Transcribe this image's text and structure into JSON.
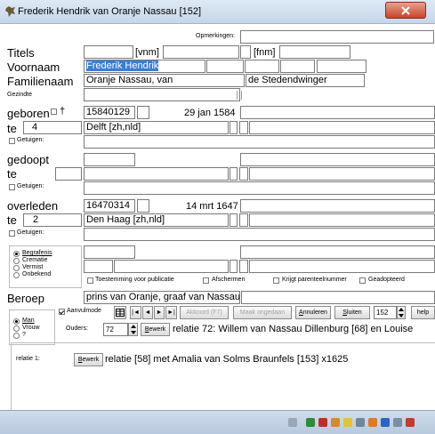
{
  "window": {
    "title": "Frederik Hendrik van Oranje Nassau [152]"
  },
  "labels": {
    "opmerkingen": "Opmerkingen:",
    "titels": "Titels",
    "vnm": "[vnm]",
    "fnm": "[fnm]",
    "voornaam": "Voornaam",
    "familienaam": "Familienaam",
    "gezindte": "Gezindte",
    "geboren": "geboren",
    "dagger": "†",
    "te": "te",
    "getuigen": "Getuigen:",
    "gedoopt": "gedoopt",
    "overleden": "overleden",
    "beroep": "Beroep",
    "toestemming": "Toestemming voor publicatie",
    "afschermen": "Afschermen",
    "krijgt_parenteelnummer": "Krijgt parenteelnummer",
    "geadopteerd": "Geadopteerd",
    "aanvulmode": "Aanvulmode",
    "ouders": "Ouders:",
    "relatie1": "relatie 1:"
  },
  "fields": {
    "voornaam": "Frederik Hendrik",
    "familienaam": "Oranje Nassau, van",
    "familienaam_extra": "de Stedendwinger",
    "geboren_date": "15840129",
    "geboren_text": "29 jan 1584",
    "geboren_te_num": "4",
    "geboren_place": "Delft [zh,nld]",
    "overleden_date": "16470314",
    "overleden_text": "14 mrt 1647",
    "overleden_te_num": "2",
    "overleden_place": "Den Haag [zh,nld]",
    "beroep": "prins van Oranje, graaf van Nassau,",
    "ouders_num": "72",
    "record_num": "152"
  },
  "burial": {
    "options": [
      "Begrafenis",
      "Crematie",
      "Vermist",
      "Onbekend"
    ],
    "selected": "Begrafenis"
  },
  "sex": {
    "options": [
      "Man",
      "Vrouw",
      "?"
    ],
    "selected": "Man"
  },
  "nav": {
    "first": "|◄",
    "prev": "◄",
    "next": "►",
    "last": "►|"
  },
  "buttons": {
    "akkoord": "Akkoord (F7)",
    "maak_ongedaan": "Maak ongedaan",
    "annuleren": "Annuleren",
    "sluiten": "Sluiten",
    "help": "help",
    "bewerk": "Bewerk"
  },
  "relations": {
    "ouders_text": "relatie 72: Willem van Nassau Dillenburg [68] en Louise",
    "relatie1_text": "relatie [58]  met Amalia van Solms Braunfels [153] x1625"
  },
  "colors": {
    "selection": "#3a7dd6",
    "titlebar": "#c6d6ea",
    "close": "#c9442b"
  }
}
